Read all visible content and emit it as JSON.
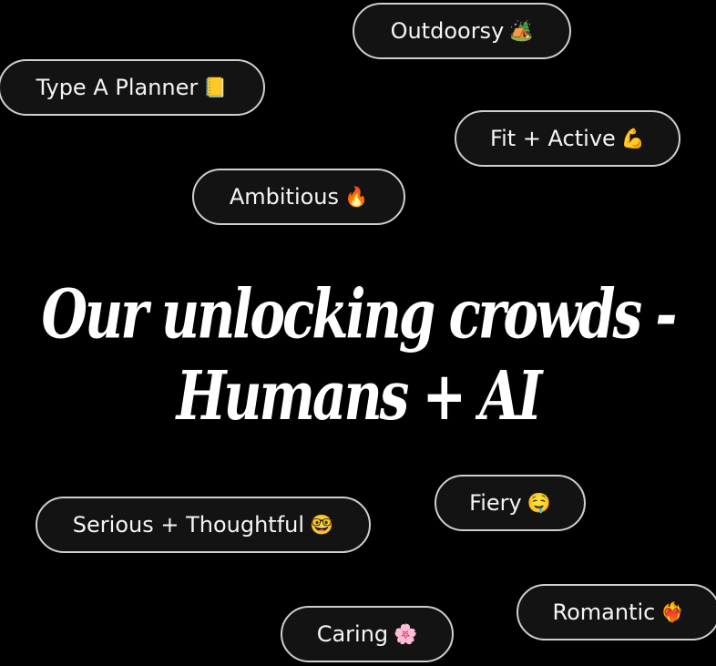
{
  "headline": {
    "line1": "Our unlocking crowds -",
    "line2": "Humans + AI"
  },
  "tags": [
    {
      "label": "Outdoorsy",
      "emoji": "🏕️",
      "icon": "camping-icon"
    },
    {
      "label": "Type A Planner",
      "emoji": "📒",
      "icon": "notebook-icon"
    },
    {
      "label": "Fit + Active",
      "emoji": "💪",
      "icon": "flexed-bicep-icon"
    },
    {
      "label": "Ambitious",
      "emoji": "🔥",
      "icon": "fire-icon"
    },
    {
      "label": "Fiery",
      "emoji": "🤤",
      "icon": "drooling-face-icon"
    },
    {
      "label": "Serious + Thoughtful",
      "emoji": "🤓",
      "icon": "nerd-face-icon"
    },
    {
      "label": "Romantic",
      "emoji": "❤️‍🔥",
      "icon": "heart-on-fire-icon"
    },
    {
      "label": "Caring",
      "emoji": "🌸",
      "icon": "cherry-blossom-icon"
    }
  ],
  "colors": {
    "background": "#000000",
    "pill_background": "#131313",
    "pill_border": "#cfcfcf",
    "text": "#ffffff"
  }
}
